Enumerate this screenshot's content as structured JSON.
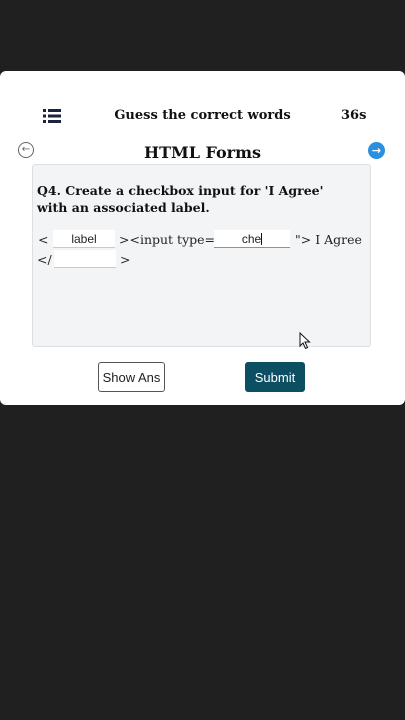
{
  "header": {
    "menu_icon": "list-icon",
    "title": "Guess the correct words",
    "timer": "36s"
  },
  "nav": {
    "prev_icon": "arrow-left-circle-icon",
    "next_icon": "arrow-right-circle-icon",
    "prev_glyph": "←",
    "next_glyph": "→",
    "next_color": "#2b8fe0"
  },
  "section_title": "HTML Forms",
  "question": {
    "text": "Q4. Create a checkbox input for 'I Agree' with an associated label.",
    "line1": {
      "open_bracket": "<",
      "blank1_value": "label",
      "middle": "><input type=\"",
      "blank2_value": "che",
      "end": "\"> I Agree"
    },
    "line2": {
      "open_bracket": "</",
      "blank3_value": "",
      "close_bracket": ">"
    }
  },
  "buttons": {
    "show_answer": "Show Ans",
    "submit": "Submit",
    "submit_color": "#0c4f63"
  }
}
